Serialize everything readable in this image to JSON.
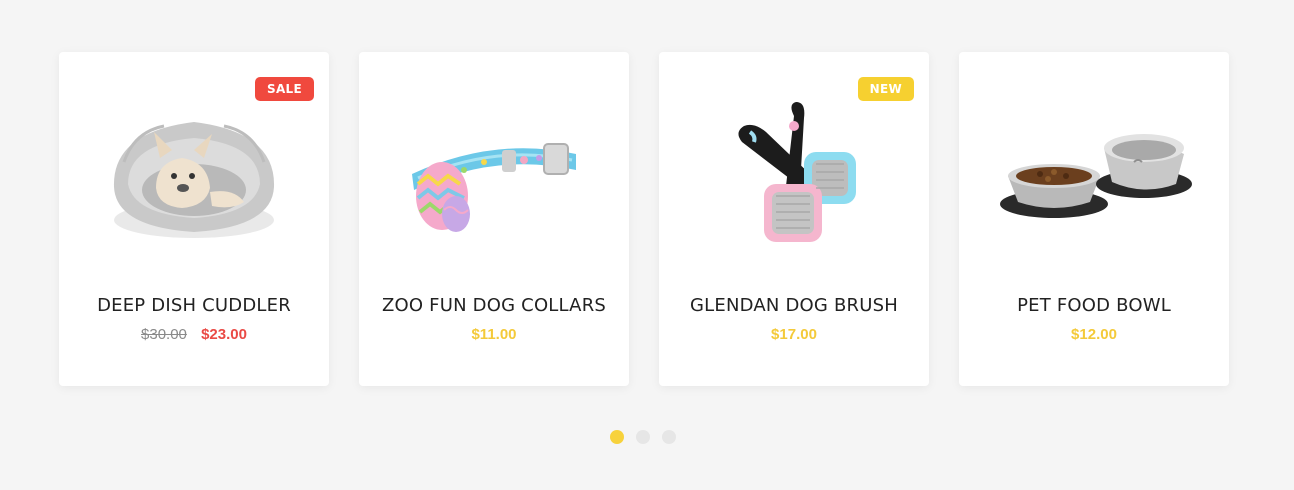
{
  "products": [
    {
      "title": "DEEP DISH CUDDLER",
      "old_price": "$30.00",
      "price": "$23.00",
      "badge": "SALE",
      "image_icon": "dog-bed-image"
    },
    {
      "title": "ZOO FUN DOG COLLARS",
      "price": "$11.00",
      "image_icon": "dog-collar-image"
    },
    {
      "title": "GLENDAN DOG BRUSH",
      "price": "$17.00",
      "badge": "NEW",
      "image_icon": "dog-brush-image"
    },
    {
      "title": "PET FOOD BOWL",
      "price": "$12.00",
      "image_icon": "food-bowl-image"
    }
  ],
  "pagination": {
    "pages": 3,
    "active_page": 1
  },
  "colors": {
    "background": "#f5f5f5",
    "sale_badge": "#f0493e",
    "new_badge": "#f6d030",
    "sale_price": "#ea4a45",
    "price": "#f4ca3a",
    "active_dot": "#f7d23c",
    "inactive_dot": "#e6e6e6"
  }
}
